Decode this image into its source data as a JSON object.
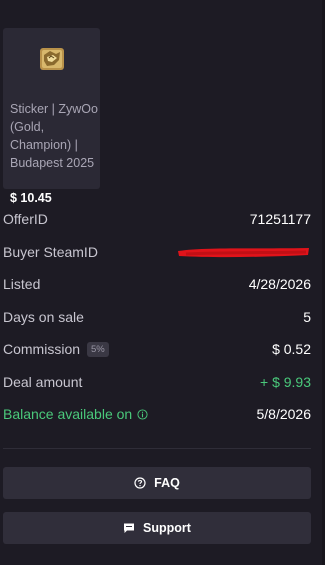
{
  "item": {
    "name": "Sticker | ZywOo (Gold, Champion) | Budapest 2025",
    "price": "$ 10.45",
    "image_icon": "sticker-icon"
  },
  "details": {
    "offer_id": {
      "label": "OfferID",
      "value": "71251177"
    },
    "buyer": {
      "label": "Buyer SteamID",
      "value": ""
    },
    "listed": {
      "label": "Listed",
      "value": "4/28/2026"
    },
    "days": {
      "label": "Days on sale",
      "value": "5"
    },
    "commission": {
      "label": "Commission",
      "badge": "5%",
      "value": "$ 0.52"
    },
    "deal": {
      "label": "Deal amount",
      "value": "+ $ 9.93"
    },
    "balance": {
      "label": "Balance available on",
      "value": "5/8/2026"
    }
  },
  "buttons": {
    "faq": "FAQ",
    "support": "Support"
  },
  "colors": {
    "background": "#1d1b24",
    "card": "#2b2935",
    "button": "#302e3a",
    "green": "#4ac97b",
    "redaction": "#e0131a"
  }
}
